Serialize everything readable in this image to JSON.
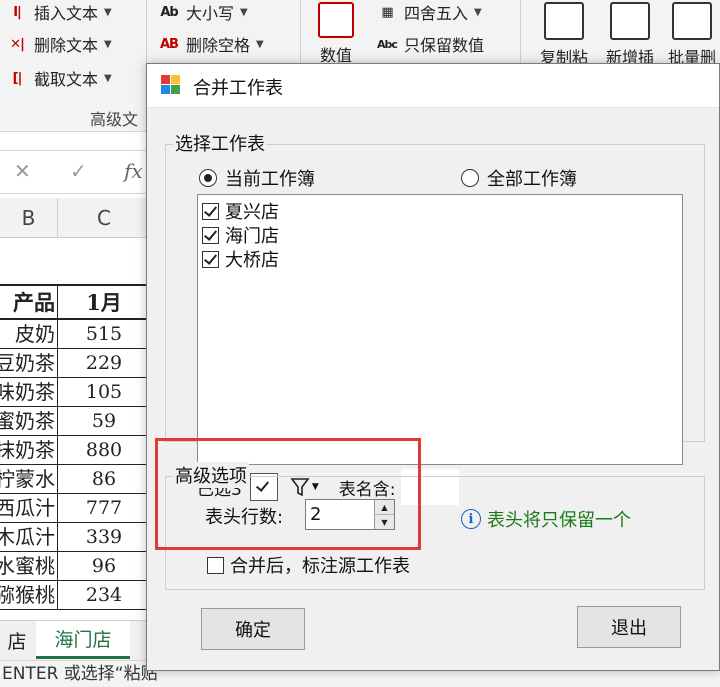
{
  "ribbon": {
    "insert_text": "插入文本",
    "delete_text": "删除文本",
    "extract_text": "截取文本",
    "case_label": "大小写",
    "case_icon_text": "Ab",
    "delete_spaces": "删除空格",
    "delete_spaces_icon_text": "AB",
    "round_label": "四舍五入",
    "keep_numbers": "只保留数值",
    "keep_numbers_icon_text": "Abc",
    "number_btn": "数值",
    "copy_paste_btn": "复制粘",
    "new_insert_btn": "新增插",
    "batch_delete_btn": "批量删",
    "group_label": "高级文"
  },
  "formula_bar": {
    "cancel_symbol": "✕",
    "confirm_symbol": "✓",
    "fx_label": "fx"
  },
  "sheet": {
    "col_b": "B",
    "col_c": "C",
    "header": {
      "name": "产品",
      "jan": "1月"
    },
    "rows": [
      {
        "name": "皮奶",
        "value": "515"
      },
      {
        "name": "豆奶茶",
        "value": "229"
      },
      {
        "name": "味奶茶",
        "value": "105"
      },
      {
        "name": "蜜奶茶",
        "value": "59"
      },
      {
        "name": "抹奶茶",
        "value": "880"
      },
      {
        "name": "柠蒙水",
        "value": "86"
      },
      {
        "name": "西瓜汁",
        "value": "777"
      },
      {
        "name": "木瓜汁",
        "value": "339"
      },
      {
        "name": "水蜜桃",
        "value": "96"
      },
      {
        "name": "猕猴桃",
        "value": "234"
      }
    ],
    "tabs": [
      {
        "label": "店"
      },
      {
        "label": "海门店"
      }
    ],
    "status_text": "ENTER 或选择“粘贴”"
  },
  "dialog": {
    "title": "合并工作表",
    "select_group_label": "选择工作表",
    "radio_current": "当前工作簿",
    "radio_all": "全部工作簿",
    "sheets": [
      {
        "name": "夏兴店",
        "checked": true
      },
      {
        "name": "海门店",
        "checked": true
      },
      {
        "name": "大桥店",
        "checked": true
      }
    ],
    "selected_count": "已选3",
    "name_contains_label": "表名含:",
    "advanced_label": "高级选项",
    "header_rows_label": "表头行数:",
    "header_rows_value": "2",
    "info_text": "表头将只保留一个",
    "mark_source_label": "合并后，标注源工作表",
    "ok_button": "确定",
    "exit_button": "退出"
  },
  "colors": {
    "excel_green": "#217346",
    "highlight_red": "#e53935",
    "info_green": "#1a7a1a",
    "info_blue": "#1565c0"
  }
}
